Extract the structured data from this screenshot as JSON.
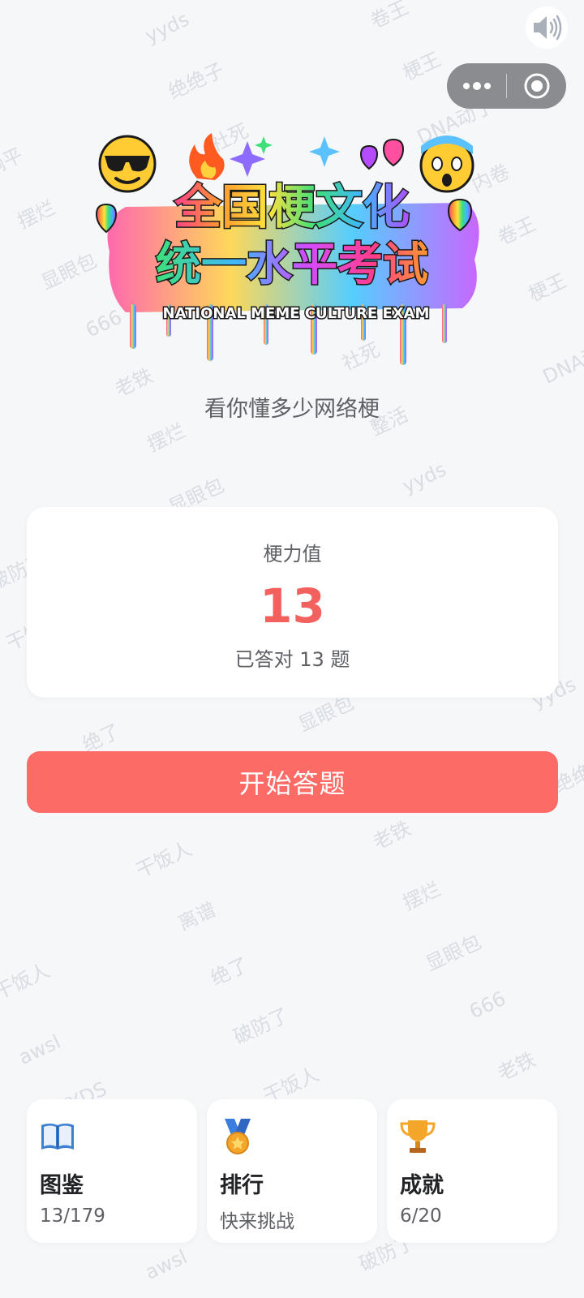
{
  "watermarks": [
    "yyds",
    "绝绝子",
    "社死",
    "梗王",
    "卷王",
    "DNA动了",
    "内卷",
    "摆烂",
    "显眼包",
    "666",
    "老铁",
    "躺平",
    "整活",
    "破防了",
    "干饭人",
    "离谱",
    "awsl",
    "绝了",
    "YYDS"
  ],
  "top_controls": {
    "sound_icon": "speaker-icon",
    "more_icon": "more-dots-icon",
    "close_icon": "target-icon"
  },
  "logo": {
    "line1": "全国梗文化",
    "line2": "统一水平考试",
    "english": "NATIONAL MEME CULTURE EXAM"
  },
  "subtitle": "看你懂多少网络梗",
  "score_card": {
    "label": "梗力值",
    "value": "13",
    "summary": "已答对 13 题"
  },
  "start_button": "开始答题",
  "bottom_cards": [
    {
      "icon": "book-icon",
      "title": "图鉴",
      "sub": "13/179"
    },
    {
      "icon": "medal-icon",
      "title": "排行",
      "sub": "快来挑战"
    },
    {
      "icon": "trophy-icon",
      "title": "成就",
      "sub": "6/20"
    }
  ],
  "colors": {
    "accent": "#fd6b67",
    "score": "#f2615d",
    "background": "#f6f7f9"
  }
}
